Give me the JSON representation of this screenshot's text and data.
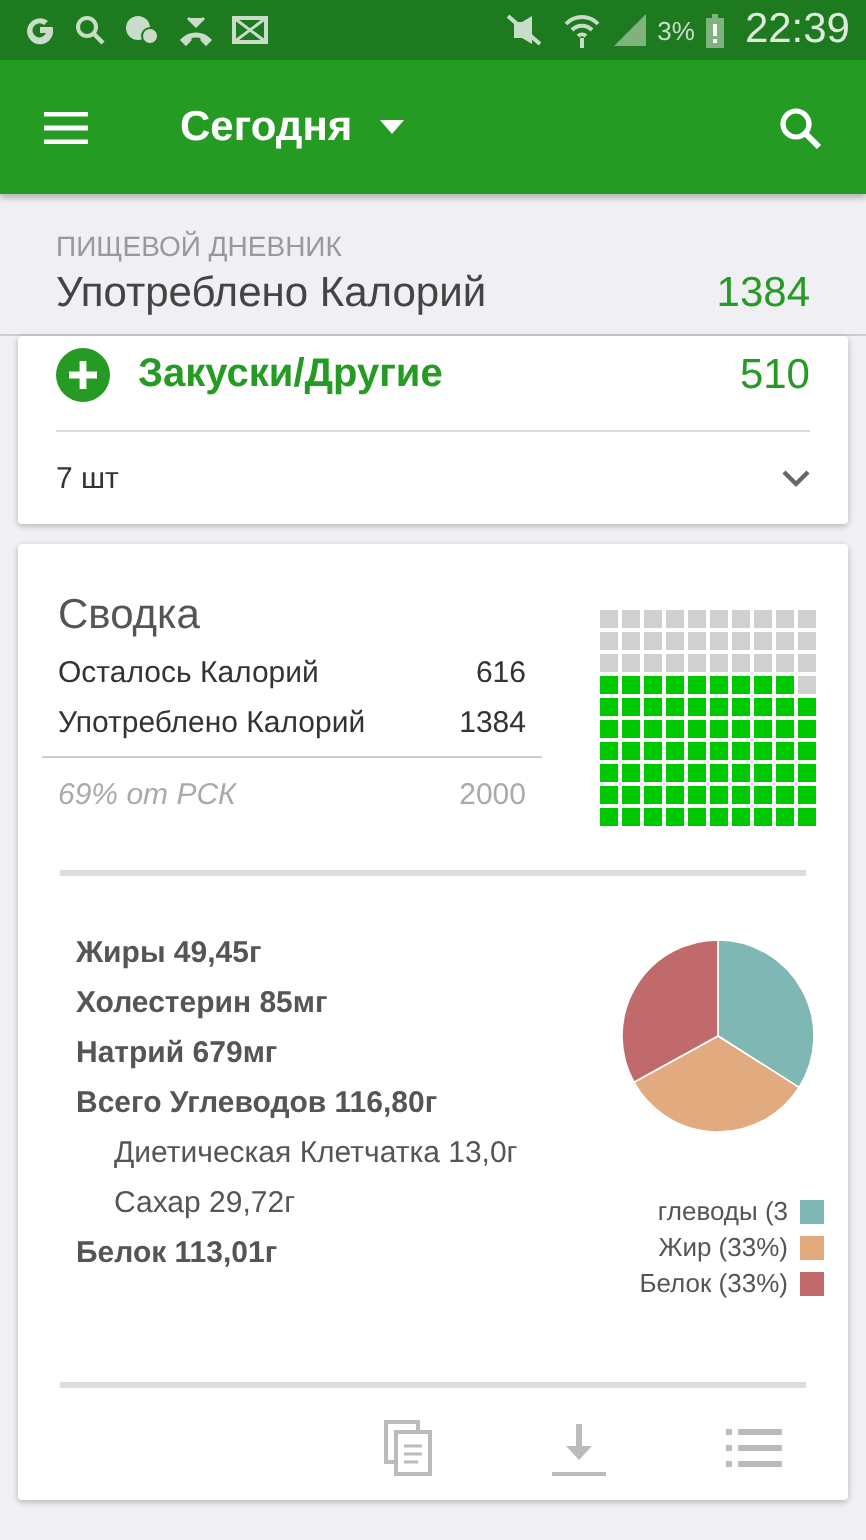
{
  "status_bar": {
    "battery": "3%",
    "time": "22:39"
  },
  "app_bar": {
    "title": "Сегодня"
  },
  "diary": {
    "section": "ПИЩЕВОЙ ДНЕВНИК",
    "label": "Употреблено Калорий",
    "value": "1384"
  },
  "meal": {
    "name": "Закуски/Другие",
    "calories": "510",
    "count": "7 шт"
  },
  "summary": {
    "title": "Сводка",
    "rows": [
      {
        "label": "Осталось Калорий",
        "value": "616"
      },
      {
        "label": "Употреблено Калорий",
        "value": "1384"
      }
    ],
    "goal_label": "69% от РСК",
    "goal_value": "2000"
  },
  "nutrients": [
    {
      "kind": "main",
      "text": "Жиры 49,45г"
    },
    {
      "kind": "main",
      "text": "Холестерин 85мг"
    },
    {
      "kind": "main",
      "text": "Натрий 679мг"
    },
    {
      "kind": "main",
      "text": "Всего Углеводов 116,80г"
    },
    {
      "kind": "sub",
      "text": "Диетическая Клетчатка 13,0г"
    },
    {
      "kind": "sub",
      "text": "Сахар 29,72г"
    },
    {
      "kind": "main",
      "text": "Белок 113,01г"
    }
  ],
  "macros": {
    "chart_data": {
      "type": "pie",
      "categories": [
        "глеводы (3",
        "Жир (33%)",
        "Белок (33%)"
      ],
      "values": [
        34,
        33,
        33
      ]
    },
    "legend": [
      {
        "color": "#7fb7b5"
      },
      {
        "color": "#e2ab7f"
      },
      {
        "color": "#c06a6b"
      }
    ]
  }
}
